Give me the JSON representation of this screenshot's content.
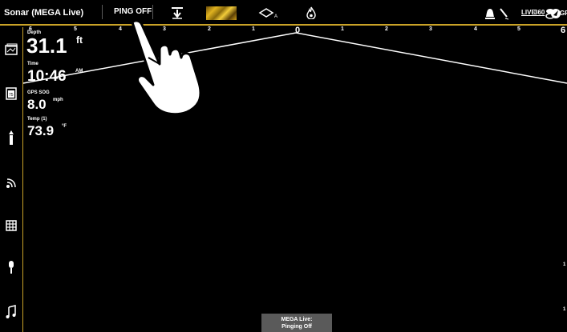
{
  "header": {
    "title": "Sonar (MEGA Live)",
    "ping_button": "PING OFF",
    "live_label": "LIVE",
    "label_360": "360",
    "gps_label": "GPS"
  },
  "scale": {
    "ticks": [
      "6",
      "5",
      "4",
      "3",
      "2",
      "1",
      "0",
      "1",
      "2",
      "3",
      "4",
      "5",
      "6"
    ]
  },
  "readouts": {
    "depth": {
      "label": "Depth",
      "value": "31.1",
      "unit": "ft"
    },
    "time": {
      "label": "Time",
      "value": "10:46",
      "unit": "AM"
    },
    "speed": {
      "label": "GPS SOG",
      "value": "8.0",
      "unit": "mph"
    },
    "temp": {
      "label": "Temp (1)",
      "value": "73.9",
      "unit": "°F"
    }
  },
  "sidebar": {
    "items": [
      "chart-icon",
      "gauge-icon",
      "boat-icon",
      "sonar-icon",
      "grid-icon",
      "microphone-icon",
      "music-icon"
    ]
  },
  "popup": {
    "line1": "MEGA Live:",
    "line2": "Pinging Off"
  },
  "right_marks": [
    "1",
    "1"
  ],
  "colors": {
    "accent": "#c9a227",
    "background": "#000000",
    "popup": "#5a5a5a"
  }
}
